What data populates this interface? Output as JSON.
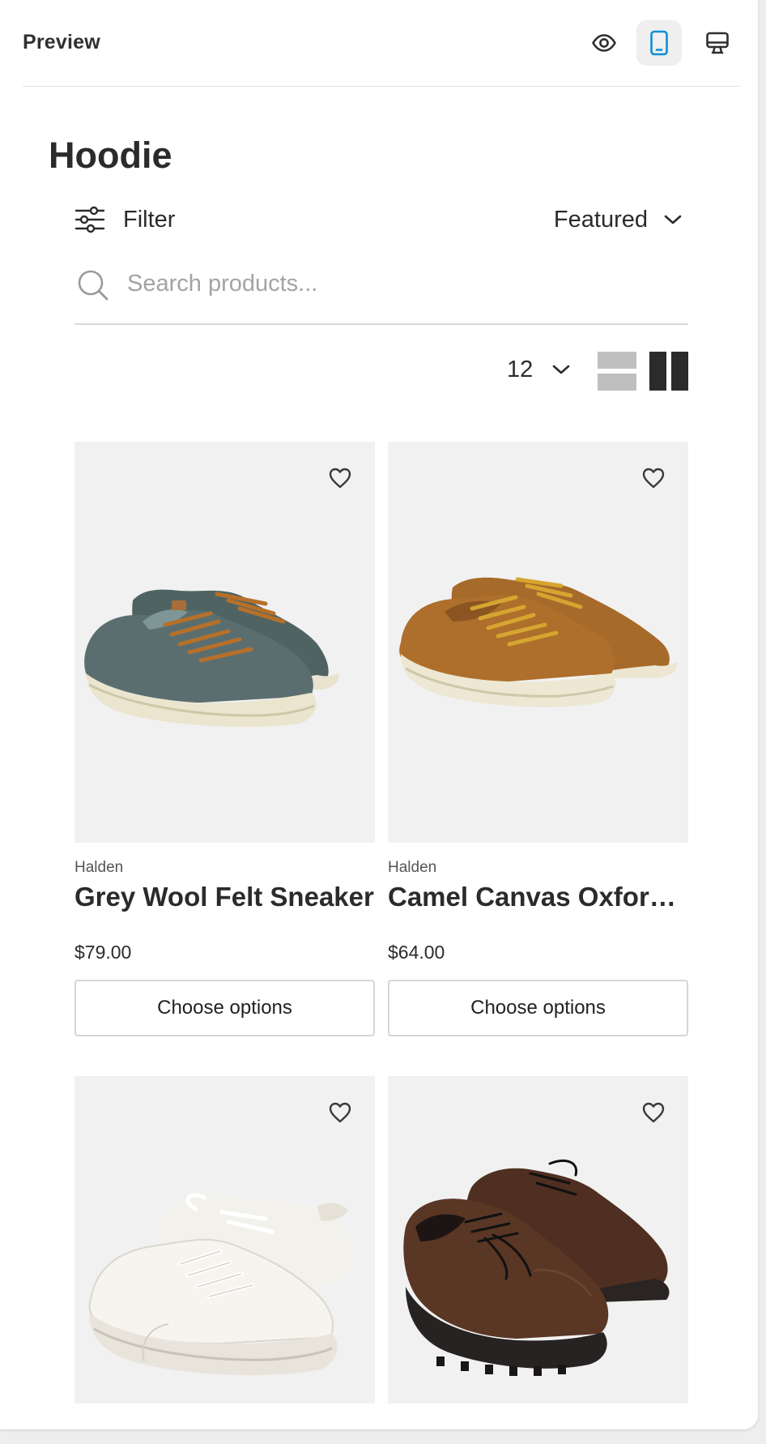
{
  "header": {
    "title": "Preview",
    "icons": [
      "eye-icon",
      "mobile-icon",
      "desktop-icon"
    ],
    "active_view": "mobile",
    "accent_color": "#0a8fd6"
  },
  "page": {
    "title": "Hoodie",
    "filter_label": "Filter",
    "sort_label": "Featured",
    "search_placeholder": "Search products...",
    "per_page": "12"
  },
  "products": [
    {
      "vendor": "Halden",
      "name": "Grey Wool Felt Sneaker",
      "price": "$79.00",
      "button": "Choose options",
      "image": "grey-felt-sneaker"
    },
    {
      "vendor": "Halden",
      "name": "Camel Canvas Oxford Sneaker",
      "price": "$64.00",
      "button": "Choose options",
      "image": "camel-canvas-sneaker"
    },
    {
      "image": "white-leather-sneaker"
    },
    {
      "image": "brown-leather-derby"
    }
  ]
}
